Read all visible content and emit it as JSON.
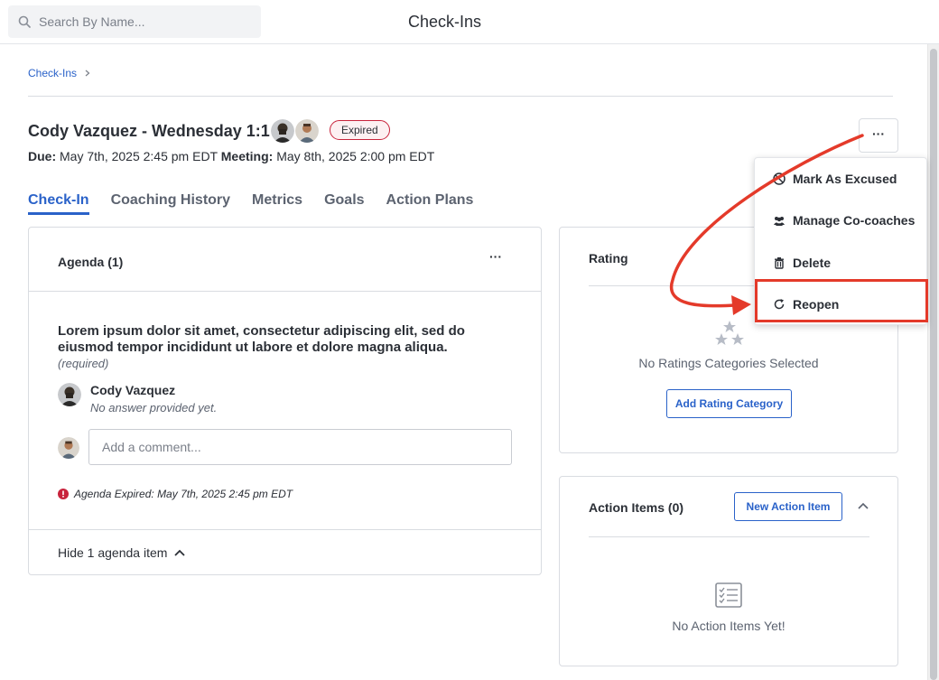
{
  "search": {
    "placeholder": "Search By Name..."
  },
  "header": {
    "title": "Check-Ins"
  },
  "breadcrumb": {
    "items": [
      "Check-Ins"
    ]
  },
  "meeting": {
    "title": "Cody Vazquez - Wednesday 1:1",
    "status": "Expired",
    "due_label": "Due:",
    "due_value": "May 7th, 2025 2:45 pm EDT",
    "meeting_label": "Meeting:",
    "meeting_value": "May 8th, 2025 2:00 pm EDT",
    "more_label": "···"
  },
  "tabs": [
    {
      "label": "Check-In",
      "active": true
    },
    {
      "label": "Coaching History"
    },
    {
      "label": "Metrics"
    },
    {
      "label": "Goals"
    },
    {
      "label": "Action Plans"
    }
  ],
  "agenda": {
    "header": "Agenda (1)",
    "more_label": "···",
    "question": "Lorem ipsum dolor sit amet, consectetur adipiscing elit, sed do eiusmod tempor incididunt ut labore et dolore magna aliqua.",
    "required": "(required)",
    "answer_author": "Cody Vazquez",
    "answer_text": "No answer provided yet.",
    "comment_placeholder": "Add a comment...",
    "expired_note": "Agenda Expired: May 7th, 2025 2:45 pm EDT",
    "hide_label": "Hide 1 agenda item"
  },
  "rating": {
    "header": "Rating",
    "empty_text": "No Ratings Categories Selected",
    "add_button": "Add Rating Category"
  },
  "action_items": {
    "header": "Action Items (0)",
    "new_button": "New Action Item",
    "empty_text": "No Action Items Yet!"
  },
  "menu": {
    "items": [
      {
        "label": "Mark As Excused",
        "icon": "ban-icon"
      },
      {
        "label": "Manage Co-coaches",
        "icon": "users-icon"
      },
      {
        "label": "Delete",
        "icon": "trash-icon"
      },
      {
        "label": "Reopen",
        "icon": "refresh-icon"
      }
    ]
  },
  "colors": {
    "accent": "#2a62c9",
    "expired_badge": "#c8233c",
    "annotation": "#e43a2a"
  }
}
